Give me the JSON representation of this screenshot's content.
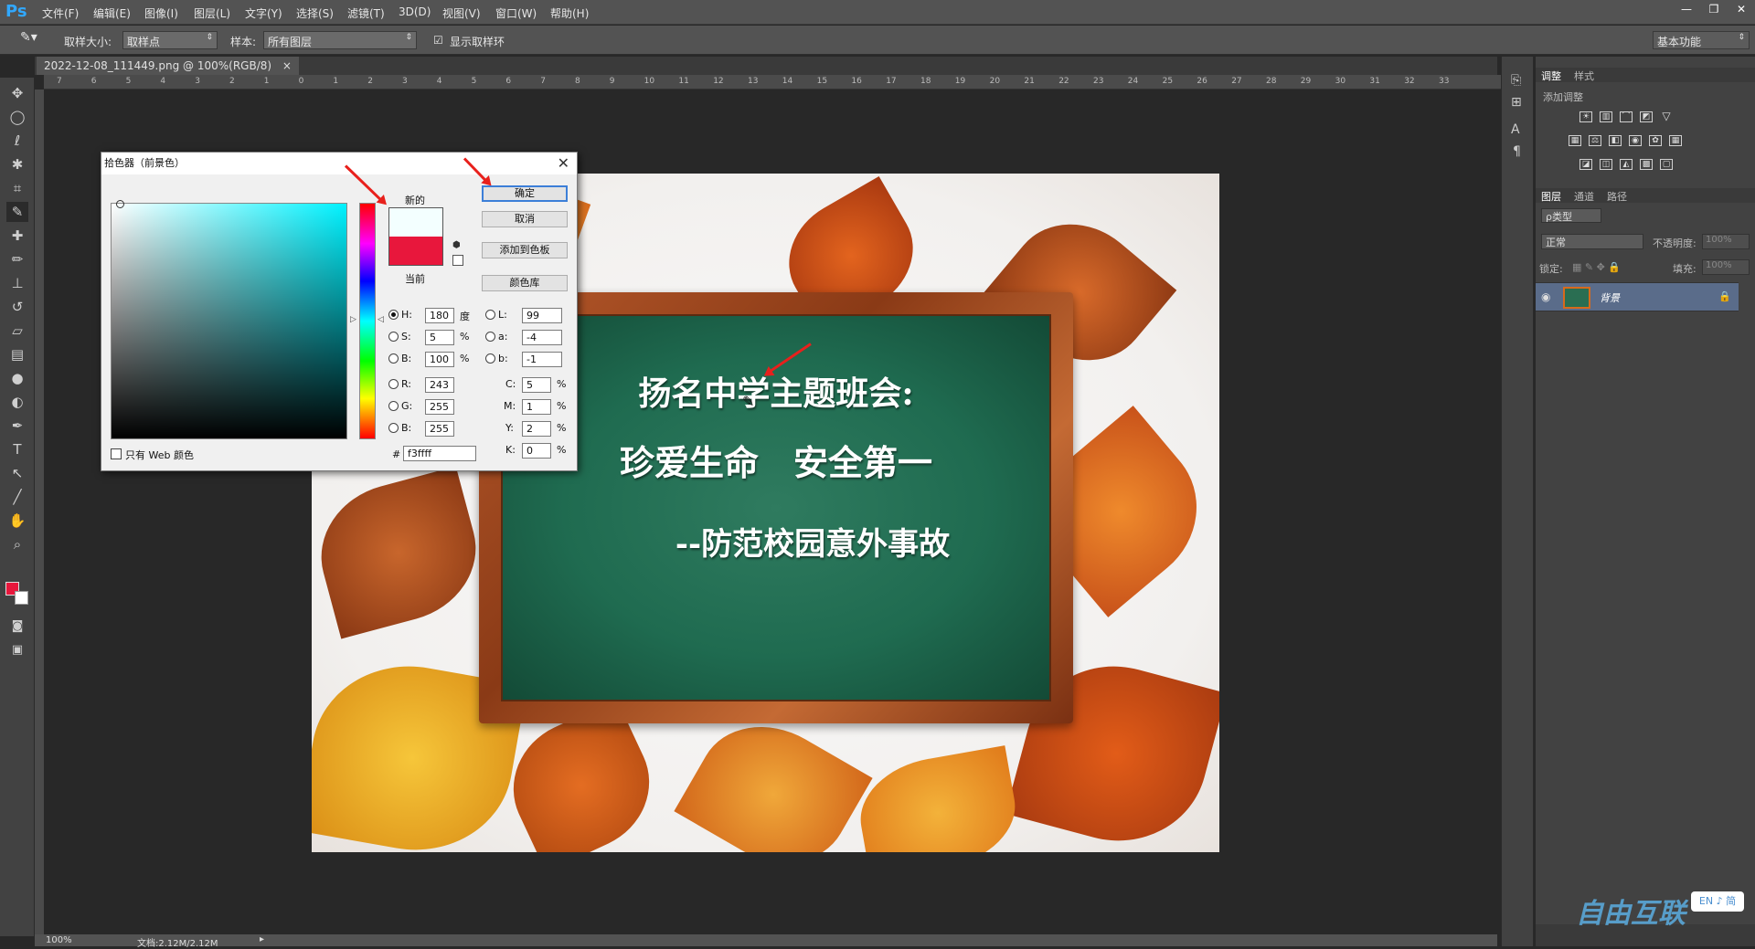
{
  "app": {
    "logo": "Ps"
  },
  "menu": [
    "文件(F)",
    "编辑(E)",
    "图像(I)",
    "图层(L)",
    "文字(Y)",
    "选择(S)",
    "滤镜(T)",
    "3D(D)",
    "视图(V)",
    "窗口(W)",
    "帮助(H)"
  ],
  "window_controls": {
    "minimize": "—",
    "restore": "❐",
    "close": "✕"
  },
  "options": {
    "sample_size_label": "取样大小:",
    "sample_size_value": "取样点",
    "sample_label": "样本:",
    "sample_value": "所有图层",
    "show_ring_label": "显示取样环",
    "workspace": "基本功能"
  },
  "document": {
    "tab_title": "2022-12-08_111449.png @ 100%(RGB/8)",
    "tab_close": "×",
    "zoom": "100%",
    "doc_info": "文档:2.12M/2.12M"
  },
  "ruler_ticks": [
    "7",
    "6",
    "5",
    "4",
    "3",
    "2",
    "1",
    "0",
    "1",
    "2",
    "3",
    "4",
    "5",
    "6",
    "7",
    "8",
    "9",
    "10",
    "11",
    "12",
    "13",
    "14",
    "15",
    "16",
    "17",
    "18",
    "19",
    "20",
    "21",
    "22",
    "23",
    "24",
    "25",
    "26",
    "27",
    "28",
    "29",
    "30",
    "31",
    "32",
    "33"
  ],
  "artwork": {
    "line1": "扬名中学主题班会:",
    "line2": "珍爱生命　安全第一",
    "line3": "--防范校园意外事故"
  },
  "color_picker": {
    "title": "拾色器（前景色）",
    "new_label": "新的",
    "current_label": "当前",
    "new_color": "#f3ffff",
    "current_color": "#e8173c",
    "buttons": {
      "ok": "确定",
      "cancel": "取消",
      "add_swatch": "添加到色板",
      "color_libraries": "颜色库"
    },
    "only_web": "只有 Web 颜色",
    "fields": {
      "H": {
        "label": "H:",
        "value": "180",
        "unit": "度"
      },
      "S": {
        "label": "S:",
        "value": "5",
        "unit": "%"
      },
      "B": {
        "label": "B:",
        "value": "100",
        "unit": "%"
      },
      "R": {
        "label": "R:",
        "value": "243"
      },
      "G": {
        "label": "G:",
        "value": "255"
      },
      "Bv": {
        "label": "B:",
        "value": "255"
      },
      "L": {
        "label": "L:",
        "value": "99"
      },
      "a": {
        "label": "a:",
        "value": "-4"
      },
      "b": {
        "label": "b:",
        "value": "-1"
      },
      "C": {
        "label": "C:",
        "value": "5",
        "unit": "%"
      },
      "M": {
        "label": "M:",
        "value": "1",
        "unit": "%"
      },
      "Y": {
        "label": "Y:",
        "value": "2",
        "unit": "%"
      },
      "K": {
        "label": "K:",
        "value": "0",
        "unit": "%"
      },
      "hex_label": "#",
      "hex": "f3ffff"
    }
  },
  "right_panel": {
    "tabs_top": [
      "调整",
      "样式"
    ],
    "add_adjustment": "添加调整",
    "tabs_layers": [
      "图层",
      "通道",
      "路径"
    ],
    "kind_label": "ρ类型",
    "blend_mode": "正常",
    "opacity_label": "不透明度:",
    "opacity_value": "100%",
    "lock_label": "锁定:",
    "fill_label": "填充:",
    "fill_value": "100%",
    "layer_name": "背景"
  },
  "watermark": {
    "text": "自由互联",
    "badge": "EN ♪ 简"
  }
}
